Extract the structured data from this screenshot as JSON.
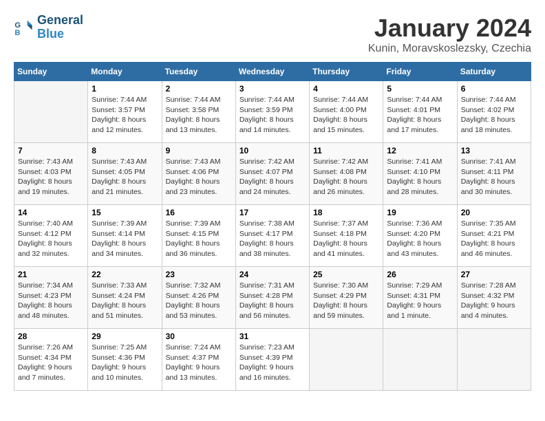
{
  "logo": {
    "line1": "General",
    "line2": "Blue"
  },
  "title": "January 2024",
  "subtitle": "Kunin, Moravskoslezsky, Czechia",
  "days_header": [
    "Sunday",
    "Monday",
    "Tuesday",
    "Wednesday",
    "Thursday",
    "Friday",
    "Saturday"
  ],
  "weeks": [
    [
      {
        "day": "",
        "info": ""
      },
      {
        "day": "1",
        "info": "Sunrise: 7:44 AM\nSunset: 3:57 PM\nDaylight: 8 hours\nand 12 minutes."
      },
      {
        "day": "2",
        "info": "Sunrise: 7:44 AM\nSunset: 3:58 PM\nDaylight: 8 hours\nand 13 minutes."
      },
      {
        "day": "3",
        "info": "Sunrise: 7:44 AM\nSunset: 3:59 PM\nDaylight: 8 hours\nand 14 minutes."
      },
      {
        "day": "4",
        "info": "Sunrise: 7:44 AM\nSunset: 4:00 PM\nDaylight: 8 hours\nand 15 minutes."
      },
      {
        "day": "5",
        "info": "Sunrise: 7:44 AM\nSunset: 4:01 PM\nDaylight: 8 hours\nand 17 minutes."
      },
      {
        "day": "6",
        "info": "Sunrise: 7:44 AM\nSunset: 4:02 PM\nDaylight: 8 hours\nand 18 minutes."
      }
    ],
    [
      {
        "day": "7",
        "info": "Sunrise: 7:43 AM\nSunset: 4:03 PM\nDaylight: 8 hours\nand 19 minutes."
      },
      {
        "day": "8",
        "info": "Sunrise: 7:43 AM\nSunset: 4:05 PM\nDaylight: 8 hours\nand 21 minutes."
      },
      {
        "day": "9",
        "info": "Sunrise: 7:43 AM\nSunset: 4:06 PM\nDaylight: 8 hours\nand 23 minutes."
      },
      {
        "day": "10",
        "info": "Sunrise: 7:42 AM\nSunset: 4:07 PM\nDaylight: 8 hours\nand 24 minutes."
      },
      {
        "day": "11",
        "info": "Sunrise: 7:42 AM\nSunset: 4:08 PM\nDaylight: 8 hours\nand 26 minutes."
      },
      {
        "day": "12",
        "info": "Sunrise: 7:41 AM\nSunset: 4:10 PM\nDaylight: 8 hours\nand 28 minutes."
      },
      {
        "day": "13",
        "info": "Sunrise: 7:41 AM\nSunset: 4:11 PM\nDaylight: 8 hours\nand 30 minutes."
      }
    ],
    [
      {
        "day": "14",
        "info": "Sunrise: 7:40 AM\nSunset: 4:12 PM\nDaylight: 8 hours\nand 32 minutes."
      },
      {
        "day": "15",
        "info": "Sunrise: 7:39 AM\nSunset: 4:14 PM\nDaylight: 8 hours\nand 34 minutes."
      },
      {
        "day": "16",
        "info": "Sunrise: 7:39 AM\nSunset: 4:15 PM\nDaylight: 8 hours\nand 36 minutes."
      },
      {
        "day": "17",
        "info": "Sunrise: 7:38 AM\nSunset: 4:17 PM\nDaylight: 8 hours\nand 38 minutes."
      },
      {
        "day": "18",
        "info": "Sunrise: 7:37 AM\nSunset: 4:18 PM\nDaylight: 8 hours\nand 41 minutes."
      },
      {
        "day": "19",
        "info": "Sunrise: 7:36 AM\nSunset: 4:20 PM\nDaylight: 8 hours\nand 43 minutes."
      },
      {
        "day": "20",
        "info": "Sunrise: 7:35 AM\nSunset: 4:21 PM\nDaylight: 8 hours\nand 46 minutes."
      }
    ],
    [
      {
        "day": "21",
        "info": "Sunrise: 7:34 AM\nSunset: 4:23 PM\nDaylight: 8 hours\nand 48 minutes."
      },
      {
        "day": "22",
        "info": "Sunrise: 7:33 AM\nSunset: 4:24 PM\nDaylight: 8 hours\nand 51 minutes."
      },
      {
        "day": "23",
        "info": "Sunrise: 7:32 AM\nSunset: 4:26 PM\nDaylight: 8 hours\nand 53 minutes."
      },
      {
        "day": "24",
        "info": "Sunrise: 7:31 AM\nSunset: 4:28 PM\nDaylight: 8 hours\nand 56 minutes."
      },
      {
        "day": "25",
        "info": "Sunrise: 7:30 AM\nSunset: 4:29 PM\nDaylight: 8 hours\nand 59 minutes."
      },
      {
        "day": "26",
        "info": "Sunrise: 7:29 AM\nSunset: 4:31 PM\nDaylight: 9 hours\nand 1 minute."
      },
      {
        "day": "27",
        "info": "Sunrise: 7:28 AM\nSunset: 4:32 PM\nDaylight: 9 hours\nand 4 minutes."
      }
    ],
    [
      {
        "day": "28",
        "info": "Sunrise: 7:26 AM\nSunset: 4:34 PM\nDaylight: 9 hours\nand 7 minutes."
      },
      {
        "day": "29",
        "info": "Sunrise: 7:25 AM\nSunset: 4:36 PM\nDaylight: 9 hours\nand 10 minutes."
      },
      {
        "day": "30",
        "info": "Sunrise: 7:24 AM\nSunset: 4:37 PM\nDaylight: 9 hours\nand 13 minutes."
      },
      {
        "day": "31",
        "info": "Sunrise: 7:23 AM\nSunset: 4:39 PM\nDaylight: 9 hours\nand 16 minutes."
      },
      {
        "day": "",
        "info": ""
      },
      {
        "day": "",
        "info": ""
      },
      {
        "day": "",
        "info": ""
      }
    ]
  ]
}
